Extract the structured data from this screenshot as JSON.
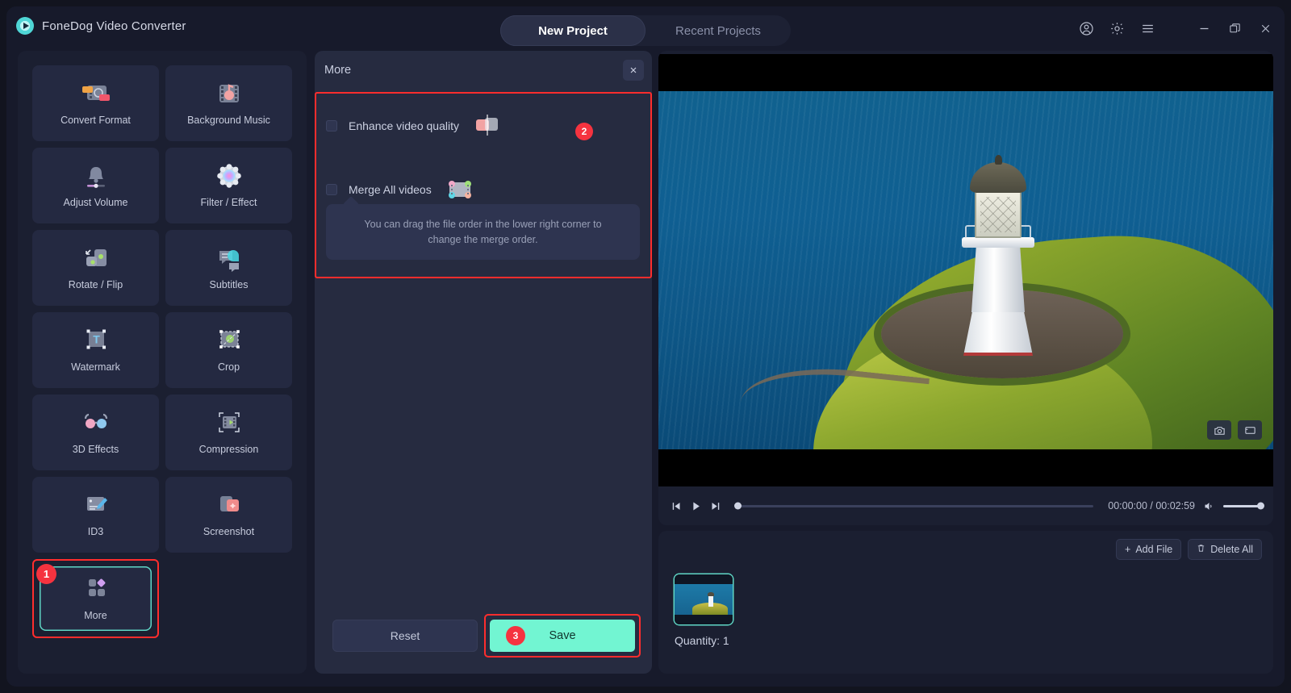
{
  "app": {
    "title": "FoneDog Video Converter",
    "logo_icon": "play-circle-logo"
  },
  "tabs": [
    {
      "label": "New Project",
      "active": true
    },
    {
      "label": "Recent Projects",
      "active": false
    }
  ],
  "window_controls": [
    {
      "name": "account-icon"
    },
    {
      "name": "gear-icon"
    },
    {
      "name": "hamburger-menu-icon"
    },
    {
      "name": "minimize-icon"
    },
    {
      "name": "maximize-icon"
    },
    {
      "name": "close-icon"
    }
  ],
  "sidebar": {
    "tools": [
      {
        "label": "Convert Format",
        "icon": "convert-format-icon"
      },
      {
        "label": "Background Music",
        "icon": "background-music-icon"
      },
      {
        "label": "Adjust Volume",
        "icon": "adjust-volume-icon"
      },
      {
        "label": "Filter / Effect",
        "icon": "filter-effect-icon"
      },
      {
        "label": "Rotate / Flip",
        "icon": "rotate-flip-icon"
      },
      {
        "label": "Subtitles",
        "icon": "subtitles-icon"
      },
      {
        "label": "Watermark",
        "icon": "watermark-icon"
      },
      {
        "label": "Crop",
        "icon": "crop-icon"
      },
      {
        "label": "3D Effects",
        "icon": "3d-effects-icon"
      },
      {
        "label": "Compression",
        "icon": "compression-icon"
      },
      {
        "label": "ID3",
        "icon": "id3-icon"
      },
      {
        "label": "Screenshot",
        "icon": "screenshot-icon"
      }
    ],
    "more": {
      "label": "More",
      "icon": "more-grid-icon",
      "badge": "1",
      "selected": true
    }
  },
  "panel": {
    "title": "More",
    "close_icon": "close-icon",
    "badge": "2",
    "options": [
      {
        "label": "Enhance video quality",
        "icon": "enhance-quality-icon",
        "checked": false
      },
      {
        "label": "Merge All videos",
        "icon": "merge-videos-icon",
        "checked": false
      }
    ],
    "tip": "You can drag the file order in the lower right corner to change the merge order.",
    "reset_label": "Reset",
    "save_label": "Save",
    "save_badge": "3"
  },
  "preview": {
    "snapshot_icon": "camera-icon",
    "fullscreen_icon": "fullscreen-icon",
    "controls": {
      "prev_icon": "skip-previous-icon",
      "play_icon": "play-icon",
      "next_icon": "skip-next-icon",
      "volume_icon": "volume-icon",
      "time": "00:00:00 / 00:02:59"
    }
  },
  "filelist": {
    "add_label": "Add File",
    "add_icon": "plus-icon",
    "delete_label": "Delete All",
    "delete_icon": "trash-icon",
    "quantity": "Quantity: 1"
  },
  "colors": {
    "accent_teal": "#5fd6c5",
    "save_green": "#72f5d2",
    "highlight_red": "#ff2d2d",
    "badge_red": "#f5333f",
    "panel_bg": "#262B40",
    "app_bg": "#171A2B"
  }
}
